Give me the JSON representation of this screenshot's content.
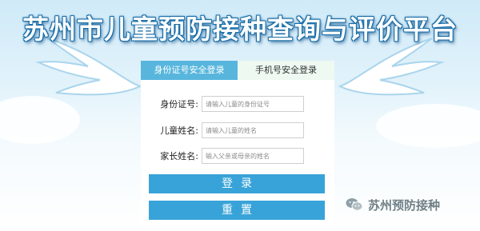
{
  "header": {
    "title": "苏州市儿童预防接种查询与评价平台"
  },
  "tabs": [
    {
      "label": "身份证号安全登录",
      "active": true
    },
    {
      "label": "手机号安全登录",
      "active": false
    }
  ],
  "form": {
    "id_label": "身份证号:",
    "id_placeholder": "请输入儿童的身份证号",
    "name_label": "儿童姓名:",
    "name_placeholder": "请输入儿童的姓名",
    "parent_label": "家长姓名:",
    "parent_placeholder": "输入父亲或母亲的姓名"
  },
  "buttons": {
    "login": "登录",
    "reset": "重置"
  },
  "watermark": {
    "text": "苏州预防接种",
    "icon": "wechat-icon"
  },
  "colors": {
    "accent": "#38a3d8",
    "tab_active": "#58b6dd",
    "tab_inactive": "#eef9f1"
  }
}
